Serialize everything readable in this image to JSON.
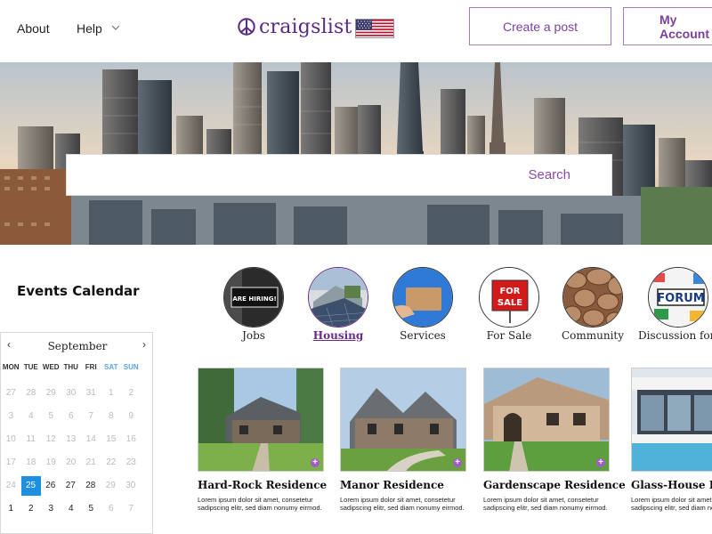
{
  "nav": {
    "about": "About",
    "help": "Help"
  },
  "logo": {
    "text": "craigslist"
  },
  "header": {
    "create_post": "Create a post",
    "my_account": "My Account"
  },
  "search": {
    "button": "Search",
    "placeholder": ""
  },
  "events": {
    "title": "Events Calendar",
    "month": "September",
    "weekdays": [
      "MON",
      "TUE",
      "WED",
      "THU",
      "FRI",
      "SAT",
      "SUN"
    ],
    "weeks": [
      [
        "27",
        "28",
        "29",
        "30",
        "31",
        "1",
        "2"
      ],
      [
        "3",
        "4",
        "5",
        "6",
        "7",
        "8",
        "9"
      ],
      [
        "10",
        "11",
        "12",
        "13",
        "14",
        "15",
        "16"
      ],
      [
        "17",
        "18",
        "19",
        "20",
        "21",
        "22",
        "23"
      ],
      [
        "24",
        "25",
        "26",
        "27",
        "28",
        "29",
        "30"
      ],
      [
        "1",
        "2",
        "3",
        "4",
        "5",
        "6",
        "7"
      ]
    ],
    "selected_day": "25"
  },
  "categories": [
    {
      "label": "Jobs",
      "icon": "hiring-sign-image",
      "image_text": "ARE HIRING!"
    },
    {
      "label": "Housing",
      "icon": "house-solar-image",
      "active": true
    },
    {
      "label": "Services",
      "icon": "card-hand-image"
    },
    {
      "label": "For Sale",
      "icon": "for-sale-sign-image",
      "image_text": [
        "FOR",
        "SALE"
      ]
    },
    {
      "label": "Community",
      "icon": "stone-wall-image"
    },
    {
      "label": "Discussion forums",
      "icon": "forum-image",
      "image_text": "FORUM"
    }
  ],
  "listings": [
    {
      "title": "Hard-Rock Residence",
      "desc": "Lorem ipsum dolor sit amet, consetetur sadipscing elitr, sed diam nonumy eirmod."
    },
    {
      "title": "Manor Residence",
      "desc": "Lorem ipsum dolor sit amet, consetetur sadipscing elitr, sed diam nonumy eirmod."
    },
    {
      "title": "Gardenscape Residence",
      "desc": "Lorem ipsum dolor sit amet, consetetur sadipscing elitr, sed diam nonumy eirmod."
    },
    {
      "title": "Glass-House Residence",
      "desc": "Lorem ipsum dolor sit amet, consetetur sadipscing elitr, sed diam nonumy eirmod."
    }
  ],
  "colors": {
    "brand": "#5a2a86",
    "accent": "#8e4aa8",
    "selected_day": "#1e8fe1"
  }
}
